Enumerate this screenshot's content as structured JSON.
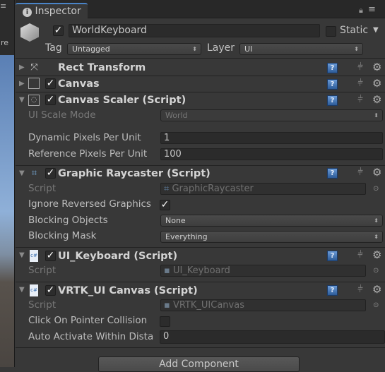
{
  "scene_strip": {
    "partial_text": "re"
  },
  "tab": {
    "label": "Inspector",
    "icon": "info-icon"
  },
  "gameobject": {
    "active": true,
    "name": "WorldKeyboard",
    "static_label": "Static",
    "static": false,
    "tag_label": "Tag",
    "tag": "Untagged",
    "layer_label": "Layer",
    "layer": "UI"
  },
  "components": {
    "rect": {
      "title": "Rect Transform"
    },
    "canvas": {
      "title": "Canvas",
      "enabled": true
    },
    "scaler": {
      "title": "Canvas Scaler (Script)",
      "enabled": true,
      "ui_scale_mode_label": "UI Scale Mode",
      "ui_scale_mode": "World",
      "dppu_label": "Dynamic Pixels Per Unit",
      "dppu": "1",
      "rppu_label": "Reference Pixels Per Unit",
      "rppu": "100"
    },
    "raycaster": {
      "title": "Graphic Raycaster (Script)",
      "enabled": true,
      "script_label": "Script",
      "script": "GraphicRaycaster",
      "ignore_label": "Ignore Reversed Graphics",
      "ignore": true,
      "blocking_objects_label": "Blocking Objects",
      "blocking_objects": "None",
      "blocking_mask_label": "Blocking Mask",
      "blocking_mask": "Everything"
    },
    "keyboard": {
      "title": "UI_Keyboard (Script)",
      "enabled": true,
      "script_label": "Script",
      "script": "UI_Keyboard"
    },
    "vrtk": {
      "title": "VRTK_UI Canvas (Script)",
      "enabled": true,
      "script_label": "Script",
      "script": "VRTK_UICanvas",
      "click_label": "Click On Pointer Collision",
      "click": false,
      "auto_label": "Auto Activate Within Dista",
      "auto": "0"
    }
  },
  "add_component": "Add Component"
}
